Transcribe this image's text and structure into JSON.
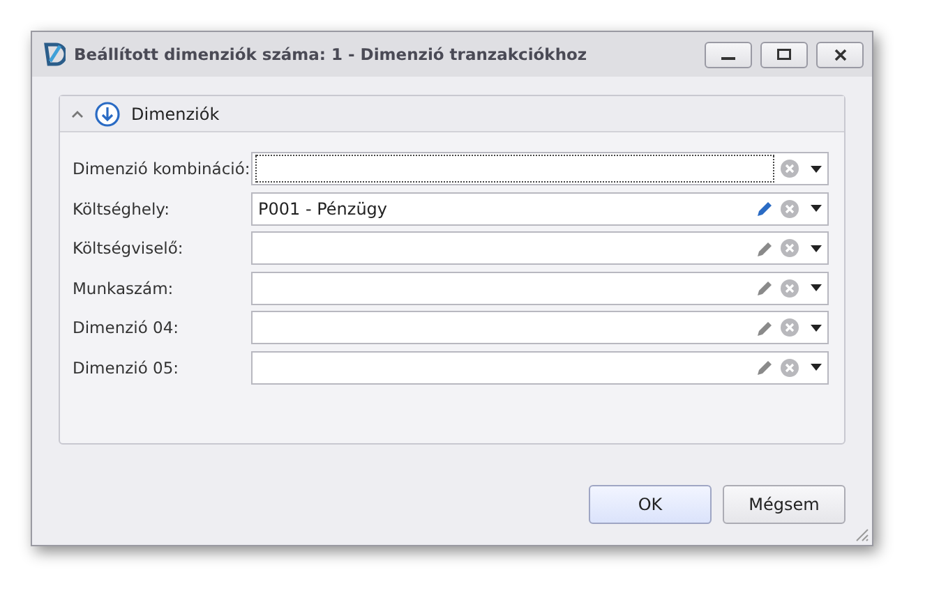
{
  "window": {
    "title": "Beállított dimenziók száma: 1 - Dimenzió tranzakciókhoz"
  },
  "group": {
    "title": "Dimenziók",
    "expanded": true
  },
  "fields": [
    {
      "kind": "combination",
      "label": "Dimenzió kombináció:",
      "focused": true
    },
    {
      "kind": "lookup",
      "label": "Költséghely:",
      "value": "P001 - Pénzügy",
      "focused": false,
      "edit_active": true
    },
    {
      "kind": "lookup",
      "label": "Költségviselő:",
      "focused": false,
      "edit_active": false
    },
    {
      "kind": "lookup",
      "label": "Munkaszám:",
      "focused": false,
      "edit_active": false
    },
    {
      "kind": "lookup",
      "label": "Dimenzió 04:",
      "focused": false,
      "edit_active": false
    },
    {
      "kind": "lookup",
      "label": "Dimenzió 05:",
      "focused": false,
      "edit_active": false
    }
  ],
  "buttons": [
    {
      "label": "OK",
      "default": true
    },
    {
      "label": "Mégsem",
      "default": false
    }
  ]
}
